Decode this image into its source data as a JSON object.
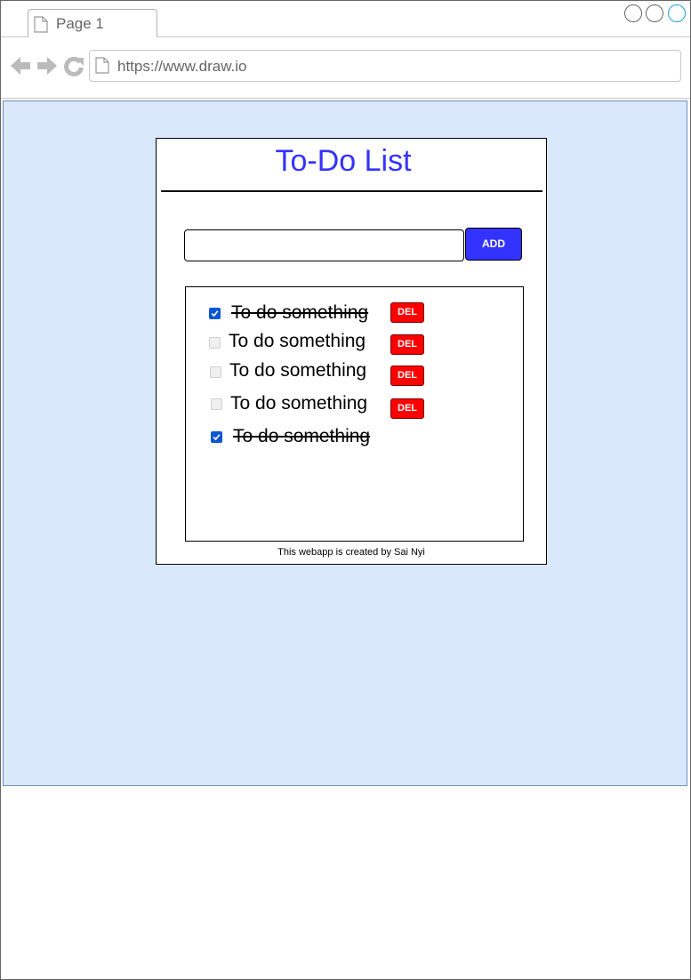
{
  "browser": {
    "tab_label": "Page 1",
    "url": "https://www.draw.io"
  },
  "app": {
    "title": "To-Do List",
    "input_value": "",
    "add_label": "ADD",
    "items": [
      {
        "text": "To do something",
        "checked": true,
        "delete_label": "DEL"
      },
      {
        "text": "To do something",
        "checked": false,
        "delete_label": "DEL"
      },
      {
        "text": "To do something",
        "checked": false,
        "delete_label": "DEL"
      },
      {
        "text": "To do something",
        "checked": false,
        "delete_label": "DEL"
      },
      {
        "text": "To do something",
        "checked": true
      }
    ],
    "footer": "This webapp is created by Sai Nyi"
  },
  "colors": {
    "canvas_background": "#dae8fc",
    "title_color": "#3333ff",
    "add_button": "#3333ff",
    "delete_button": "#ff0000",
    "checkbox_checked": "#0b57d0"
  }
}
